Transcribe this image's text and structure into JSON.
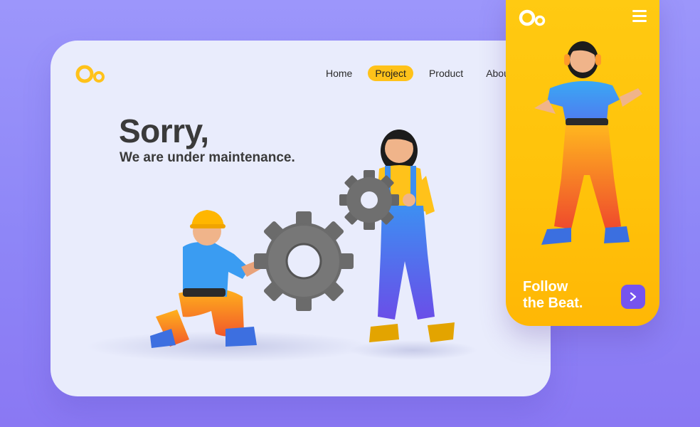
{
  "site": {
    "logo_icon": "ring-logo-icon",
    "accent_color": "#ffc21a",
    "background_color": "#e9ecfc"
  },
  "nav": {
    "items": [
      {
        "label": "Home",
        "active": false
      },
      {
        "label": "Project",
        "active": true
      },
      {
        "label": "Product",
        "active": false
      },
      {
        "label": "About",
        "active": false
      }
    ]
  },
  "hero": {
    "title": "Sorry,",
    "subtitle": "We are under maintenance."
  },
  "mobile": {
    "menu_icon": "hamburger-menu-icon",
    "tagline_line1": "Follow",
    "tagline_line2": "the Beat.",
    "next_label": ">",
    "button_color": "#7654ee"
  }
}
